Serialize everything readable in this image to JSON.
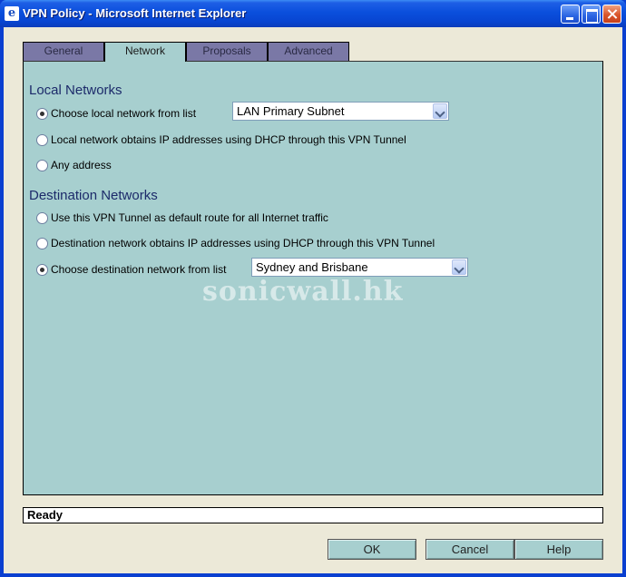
{
  "window": {
    "title": "VPN Policy - Microsoft Internet Explorer",
    "app_icon": "ie-icon",
    "app_icon_glyph": "e"
  },
  "tabs": [
    {
      "label": "General",
      "active": false
    },
    {
      "label": "Network",
      "active": true
    },
    {
      "label": "Proposals",
      "active": false
    },
    {
      "label": "Advanced",
      "active": false
    }
  ],
  "local_networks": {
    "title": "Local Networks",
    "options": [
      {
        "label": "Choose local network from list",
        "selected": true
      },
      {
        "label": "Local network obtains IP addresses using DHCP through this VPN Tunnel",
        "selected": false
      },
      {
        "label": "Any address",
        "selected": false
      }
    ],
    "select_value": "LAN Primary Subnet"
  },
  "destination_networks": {
    "title": "Destination Networks",
    "options": [
      {
        "label": "Use this VPN Tunnel as default route for all Internet traffic",
        "selected": false
      },
      {
        "label": "Destination network obtains IP addresses using DHCP through this VPN Tunnel",
        "selected": false
      },
      {
        "label": "Choose destination network from list",
        "selected": true
      }
    ],
    "select_value": "Sydney and Brisbane"
  },
  "watermark": "sonicwall.hk",
  "status": "Ready",
  "buttons": {
    "ok": "OK",
    "cancel": "Cancel",
    "help": "Help"
  },
  "colors": {
    "panel": "#a7cfcf",
    "inactive_tab": "#7a78a6",
    "titlebar": "#0a4fdc",
    "section_title": "#1c2a6a"
  }
}
